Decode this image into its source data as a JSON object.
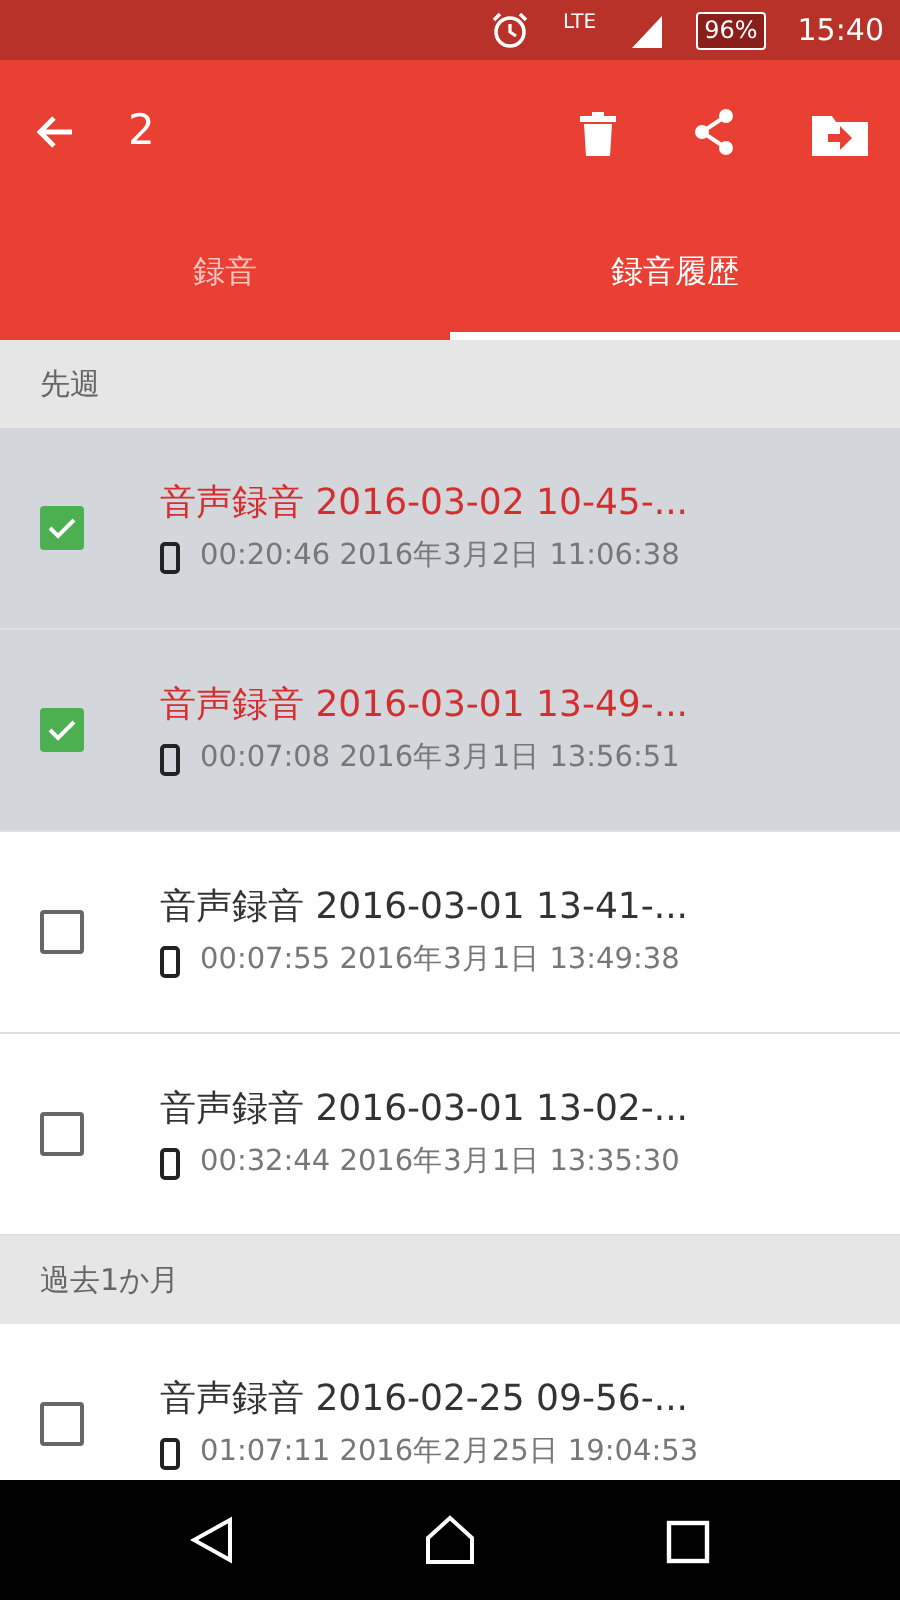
{
  "status_bar": {
    "network": "LTE",
    "battery": "96%",
    "time": "15:40"
  },
  "toolbar": {
    "selection_count": "2"
  },
  "tabs": [
    {
      "label": "録音",
      "selected": false
    },
    {
      "label": "録音履歴",
      "selected": true
    }
  ],
  "sections": [
    {
      "header": "先週",
      "items": [
        {
          "title": "音声録音 2016-03-02 10-45-...",
          "details": "00:20:46 2016年3月2日 11:06:38",
          "checked": true
        },
        {
          "title": "音声録音 2016-03-01 13-49-...",
          "details": "00:07:08 2016年3月1日 13:56:51",
          "checked": true
        },
        {
          "title": "音声録音 2016-03-01 13-41-...",
          "details": "00:07:55 2016年3月1日 13:49:38",
          "checked": false
        },
        {
          "title": "音声録音 2016-03-01 13-02-...",
          "details": "00:32:44 2016年3月1日 13:35:30",
          "checked": false
        }
      ]
    },
    {
      "header": "過去1か月",
      "items": [
        {
          "title": "音声録音 2016-02-25 09-56-...",
          "details": "01:07:11 2016年2月25日 19:04:53",
          "checked": false
        }
      ]
    }
  ]
}
